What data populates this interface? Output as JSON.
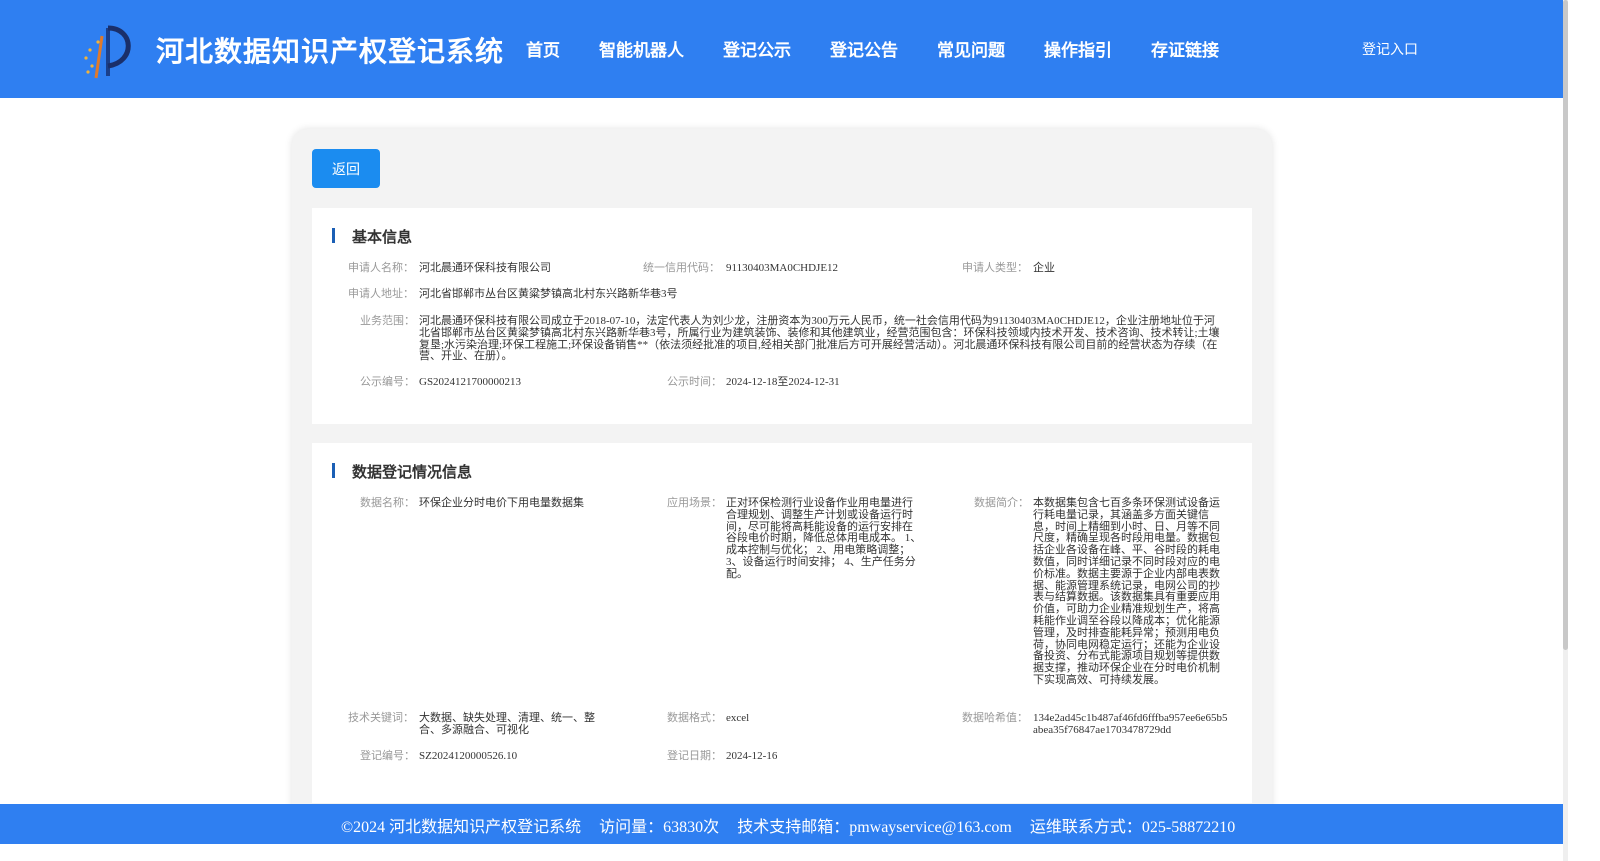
{
  "header": {
    "title": "河北数据知识产权登记系统",
    "nav": [
      "首页",
      "智能机器人",
      "登记公示",
      "登记公告",
      "常见问题",
      "操作指引",
      "存证链接"
    ],
    "login": "登记入口"
  },
  "back_label": "返回",
  "basic": {
    "title": "基本信息",
    "applicant_name_label": "申请人名称：",
    "applicant_name": "河北晨通环保科技有限公司",
    "credit_code_label": "统一信用代码：",
    "credit_code": "91130403MA0CHDJE12",
    "applicant_type_label": "申请人类型：",
    "applicant_type": "企业",
    "address_label": "申请人地址：",
    "address": "河北省邯郸市丛台区黄粱梦镇高北村东兴路新华巷3号",
    "scope_label": "业务范围：",
    "scope": "河北晨通环保科技有限公司成立于2018-07-10，法定代表人为刘少龙，注册资本为300万元人民币，统一社会信用代码为91130403MA0CHDJE12，企业注册地址位于河北省邯郸市丛台区黄粱梦镇高北村东兴路新华巷3号，所属行业为建筑装饰、装修和其他建筑业，经营范围包含：环保科技领域内技术开发、技术咨询、技术转让;土壤复垦;水污染治理;环保工程施工;环保设备销售**（依法须经批准的项目,经相关部门批准后方可开展经营活动）。河北晨通环保科技有限公司目前的经营状态为存续（在营、开业、在册）。",
    "pub_no_label": "公示编号：",
    "pub_no": "GS2024121700000213",
    "pub_time_label": "公示时间：",
    "pub_time": "2024-12-18至2024-12-31"
  },
  "data_info": {
    "title": "数据登记情况信息",
    "name_label": "数据名称：",
    "name": "环保企业分时电价下用电量数据集",
    "scene_label": "应用场景：",
    "scene": "正对环保检测行业设备作业用电量进行合理规划、调整生产计划或设备运行时间，尽可能将高耗能设备的运行安排在谷段电价时期，降低总体用电成本。 1、成本控制与优化； 2、用电策略调整； 3、设备运行时间安排； 4、生产任务分配。",
    "intro_label": "数据简介：",
    "intro": "本数据集包含七百多条环保测试设备运行耗电量记录，其涵盖多方面关键信息，时间上精细到小时、日、月等不同尺度，精确呈现各时段用电量。数据包括企业各设备在峰、平、谷时段的耗电数值，同时详细记录不同时段对应的电价标准。数据主要源于企业内部电表数据、能源管理系统记录，电网公司的抄表与结算数据。该数据集具有重要应用价值，可助力企业精准规划生产，将高耗能作业调至谷段以降成本；优化能源管理，及时排查能耗异常；预测用电负荷，协同电网稳定运行；还能为企业设备投资、分布式能源项目规划等提供数据支撑，推动环保企业在分时电价机制下实现高效、可持续发展。",
    "keywords_label": "技术关键词：",
    "keywords": "大数据、缺失处理、清理、统一、整合、多源融合、可视化",
    "format_label": "数据格式：",
    "format": "excel",
    "hash_label": "数据哈希值：",
    "hash": "134e2ad45c1b487af46fd6fffba957ee6e65b5abea35f76847ae1703478729dd",
    "reg_no_label": "登记编号：",
    "reg_no": "SZ2024120000526.10",
    "reg_date_label": "登记日期：",
    "reg_date": "2024-12-16"
  },
  "footer": {
    "copyright": "©2024 河北数据知识产权登记系统",
    "visits": "访问量：63830次",
    "email": "技术支持邮箱：pmwayservice@163.com",
    "phone": "运维联系方式：025-58872210"
  }
}
